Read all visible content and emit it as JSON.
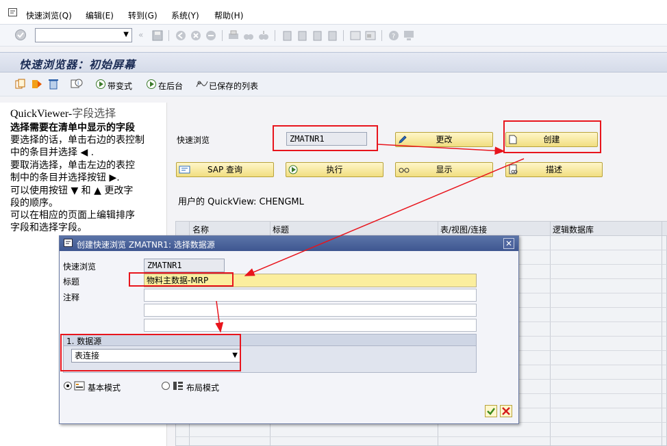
{
  "menu": {
    "items": [
      "快速浏览(Q)",
      "编辑(E)",
      "转到(G)",
      "系统(Y)",
      "帮助(H)"
    ]
  },
  "page_title": "快速浏览器：初始屏幕",
  "app_toolbar": {
    "mode_with_variant": "带变式",
    "in_background": "在后台",
    "saved_lists": "已保存的列表"
  },
  "help": {
    "heading_prefix": "QuickViewer-",
    "heading_suffix": "字段选择",
    "subheading": "选择需要在清单中显示的字段",
    "lines": [
      "要选择的话，单击右边的表控制",
      "中的条目并选择 ◀ .",
      "要取消选择，单击左边的表控",
      "制中的条目并选择按钮 ▶.",
      "可以使用按钮 ▼ 和 ▲ 更改字",
      "段的顺序。",
      "可以在相应的页面上编辑排序",
      "字段和选择字段。"
    ]
  },
  "form": {
    "quickview_label": "快速浏览",
    "quickview_value": "ZMATNR1",
    "change_button": "更改",
    "create_button": "创建",
    "sap_query_button": "SAP 查询",
    "execute_button": "执行",
    "display_button": "显示",
    "describe_button": "描述",
    "user_quickviews": "用户的 QuickView: CHENGML"
  },
  "grid": {
    "columns": [
      "名称",
      "标题",
      "表/视图/连接",
      "逻辑数据库"
    ]
  },
  "dialog": {
    "title": "创建快速浏览 ZMATNR1: 选择数据源",
    "quickview_label": "快速浏览",
    "quickview_value": "ZMATNR1",
    "title_label": "标题",
    "title_value": "物料主数据-MRP",
    "notes_label": "注释",
    "datasource_group": "1. 数据源",
    "datasource_value": "表连接",
    "basic_mode": "基本模式",
    "layout_mode": "布局模式"
  },
  "colors": {
    "annotation_red": "#e8141c",
    "button_yellow": "#f1de80",
    "title_blue": "#3e5690"
  }
}
